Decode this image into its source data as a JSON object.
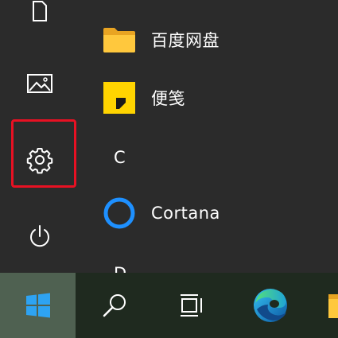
{
  "left_rail": {
    "items": [
      {
        "icon": "document-icon"
      },
      {
        "icon": "pictures-icon"
      },
      {
        "icon": "gear-icon",
        "highlighted": true,
        "highlight_color": "#e81123"
      },
      {
        "icon": "power-icon"
      }
    ]
  },
  "app_list": {
    "apps": [
      {
        "label": "百度网盘",
        "icon": "folder-icon"
      },
      {
        "label": "便笺",
        "icon": "sticky-notes-icon"
      }
    ],
    "section_c_letter": "C",
    "cortana_label": "Cortana",
    "section_d_letter": "D"
  },
  "taskbar": {
    "buttons": [
      {
        "icon": "windows-start-icon",
        "active": true
      },
      {
        "icon": "search-icon"
      },
      {
        "icon": "task-view-icon"
      },
      {
        "icon": "edge-icon"
      },
      {
        "icon": "file-explorer-icon"
      }
    ]
  },
  "colors": {
    "menu_bg": "#2b2b2b",
    "taskbar_bg": "#1f2a1f",
    "start_active_bg": "#4f6151",
    "highlight": "#e81123",
    "cortana_ring": "#1e90ff",
    "sticky_yellow": "#ffd400"
  }
}
